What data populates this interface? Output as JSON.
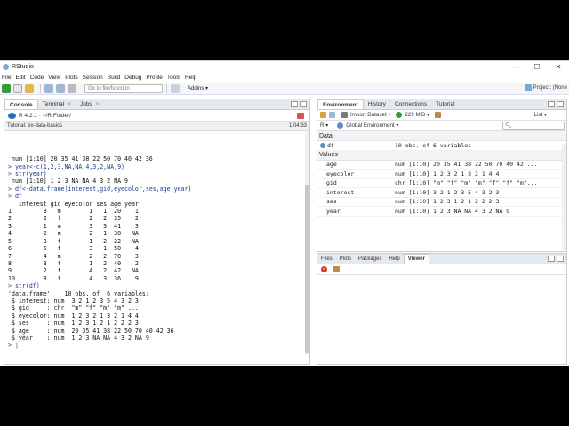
{
  "window": {
    "title": "RStudio",
    "controls": [
      "—",
      "☐",
      "✕"
    ]
  },
  "menu": [
    "File",
    "Edit",
    "Code",
    "View",
    "Plots",
    "Session",
    "Build",
    "Debug",
    "Profile",
    "Tools",
    "Help"
  ],
  "toolbar": {
    "goto_placeholder": "Go to file/function",
    "addins_label": "Addins ▾",
    "project_label": "Project: (None"
  },
  "left_pane": {
    "tabs": [
      {
        "label": "Console"
      },
      {
        "label": "Terminal"
      },
      {
        "label": "Jobs"
      }
    ],
    "r_version": "R 4.2.1 · ~/R Folder/",
    "tutorial_label": "Tutorial: ex-data-basics",
    "tutorial_time": "1:04:33",
    "console_lines": [
      {
        "t": " num [1:10] 20 35 41 38 22 50 70 40 42 36",
        "c": false
      },
      {
        "t": "> year<-c(1,2,3,NA,NA,4,3,2,NA,9)",
        "c": true
      },
      {
        "t": "> str(year)",
        "c": true
      },
      {
        "t": " num [1:10] 1 2 3 NA NA 4 3 2 NA 9",
        "c": false
      },
      {
        "t": "> df<-data.frame(interest,gid,eyecolor,ses,age,year)",
        "c": true
      },
      {
        "t": "> df",
        "c": true
      },
      {
        "t": "   interest gid eyecolor ses age year",
        "c": false
      },
      {
        "t": "1         3   m        1   1  20    1",
        "c": false
      },
      {
        "t": "2         2   f        2   2  35    2",
        "c": false
      },
      {
        "t": "3         1   m        3   3  41    3",
        "c": false
      },
      {
        "t": "4         2   m        2   1  38   NA",
        "c": false
      },
      {
        "t": "5         3   f        1   2  22   NA",
        "c": false
      },
      {
        "t": "6         5   f        3   1  50    4",
        "c": false
      },
      {
        "t": "7         4   m        2   2  70    3",
        "c": false
      },
      {
        "t": "8         3   f        1   2  40    2",
        "c": false
      },
      {
        "t": "9         2   f        4   2  42   NA",
        "c": false
      },
      {
        "t": "10        3   f        4   3  36    9",
        "c": false
      },
      {
        "t": "> str(df)",
        "c": true
      },
      {
        "t": "'data.frame':   10 obs. of  6 variables:",
        "c": false
      },
      {
        "t": " $ interest: num  3 2 1 2 3 5 4 3 2 3",
        "c": false
      },
      {
        "t": " $ gid     : chr  \"m\" \"f\" \"m\" \"m\" ...",
        "c": false
      },
      {
        "t": " $ eyecolor: num  1 2 3 2 1 3 2 1 4 4",
        "c": false
      },
      {
        "t": " $ ses     : num  1 2 3 1 2 1 2 2 2 3",
        "c": false
      },
      {
        "t": " $ age     : num  20 35 41 38 22 50 70 40 42 36",
        "c": false
      },
      {
        "t": " $ year    : num  1 2 3 NA NA 4 3 2 NA 9",
        "c": false
      },
      {
        "t": "> |",
        "c": true
      }
    ]
  },
  "env_pane": {
    "tabs": [
      {
        "label": "Environment"
      },
      {
        "label": "History"
      },
      {
        "label": "Connections"
      },
      {
        "label": "Tutorial"
      }
    ],
    "import_label": "Import Dataset ▾",
    "memory_label": "229 MiB ▾",
    "list_label": "List ▾",
    "r_label": "R ▾",
    "scope_label": "Global Environment ▾",
    "data_header": "Data",
    "values_header": "Values",
    "data_rows": [
      {
        "name": "df",
        "value": "10 obs. of 6 variables"
      }
    ],
    "value_rows": [
      {
        "name": "age",
        "value": "num [1:10] 20 35 41 38 22 50 70 40 42 ..."
      },
      {
        "name": "eyecolor",
        "value": "num [1:10] 1 2 3 2 1 3 2 1 4 4"
      },
      {
        "name": "gid",
        "value": "chr [1:10] \"m\" \"f\" \"m\" \"m\" \"f\" \"f\" \"m\"..."
      },
      {
        "name": "interest",
        "value": "num [1:10] 3 2 1 2 3 5 4 3 2 3"
      },
      {
        "name": "ses",
        "value": "num [1:10] 1 2 3 1 2 1 2 2 2 3"
      },
      {
        "name": "year",
        "value": "num [1:10] 1 2 3 NA NA 4 3 2 NA 9"
      }
    ]
  },
  "viewer_pane": {
    "tabs": [
      {
        "label": "Files"
      },
      {
        "label": "Plots"
      },
      {
        "label": "Packages"
      },
      {
        "label": "Help"
      },
      {
        "label": "Viewer"
      }
    ]
  }
}
